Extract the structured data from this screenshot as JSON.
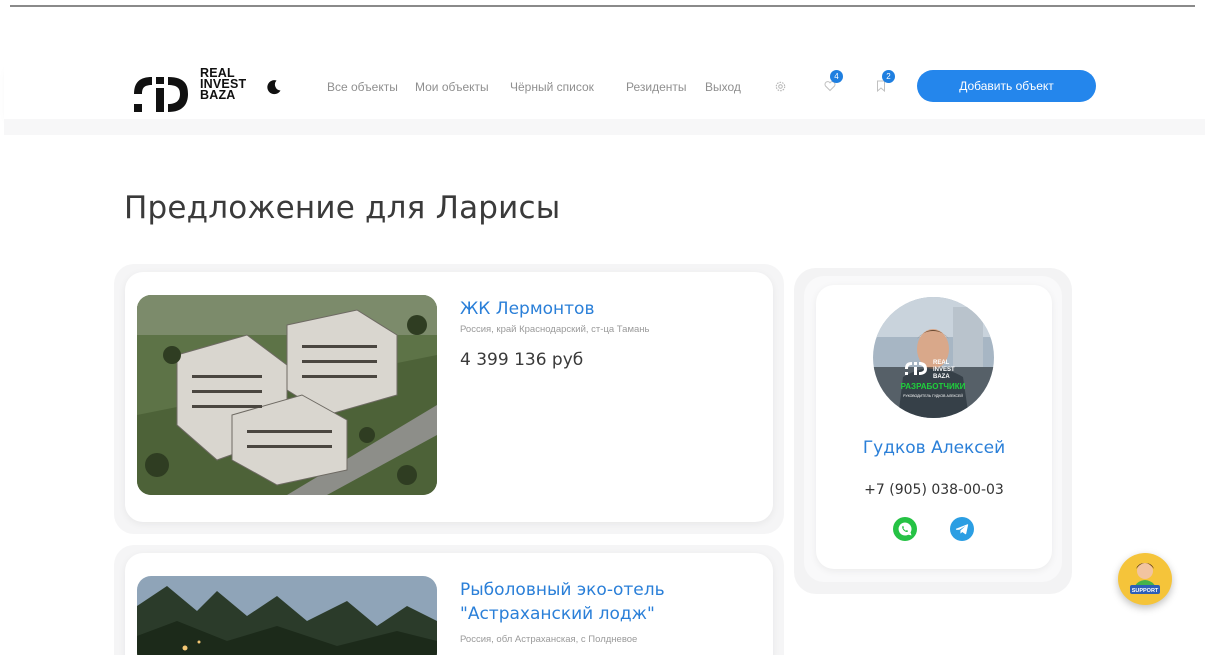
{
  "header": {
    "logo_lines": [
      "REAL",
      "INVEST",
      "BAZA"
    ],
    "nav": [
      {
        "label": "Все объекты"
      },
      {
        "label": "Мои объекты"
      },
      {
        "label": "Чёрный список"
      },
      {
        "label": "Резиденты"
      },
      {
        "label": "Выход"
      }
    ],
    "favorites_count": "4",
    "bookmarks_count": "2",
    "add_button": "Добавить объект"
  },
  "page": {
    "title": "Предложение для Ларисы"
  },
  "objects": [
    {
      "title": "ЖК Лермонтов",
      "address": "Россия, край Краснодарский, ст-ца Тамань",
      "price": "4 399 136 руб"
    },
    {
      "title": "Рыболовный эко-отель \"Астраханский лодж\"",
      "address": "Россия, обл Астраханская, с Полдневое",
      "price": ""
    }
  ],
  "agent": {
    "name": "Гудков Алексей",
    "phone": "+7 (905) 038-00-03",
    "avatar_text": [
      "REAL",
      "INVEST",
      "BAZA"
    ],
    "avatar_caption": "РАЗРАБОТЧИКИ",
    "avatar_subcaption": "РУКОВОДИТЕЛЬ ГУДКОВ АЛЕКСЕЙ"
  },
  "support_label": "SUPPORT",
  "colors": {
    "accent": "#2486ec",
    "link": "#2a7fd8",
    "whatsapp": "#25c244",
    "telegram": "#2b9ee3",
    "support": "#f5c43a"
  },
  "icons": [
    "moon-icon",
    "gear-icon",
    "heart-icon",
    "bookmark-icon",
    "whatsapp-icon",
    "telegram-icon",
    "support-icon"
  ]
}
